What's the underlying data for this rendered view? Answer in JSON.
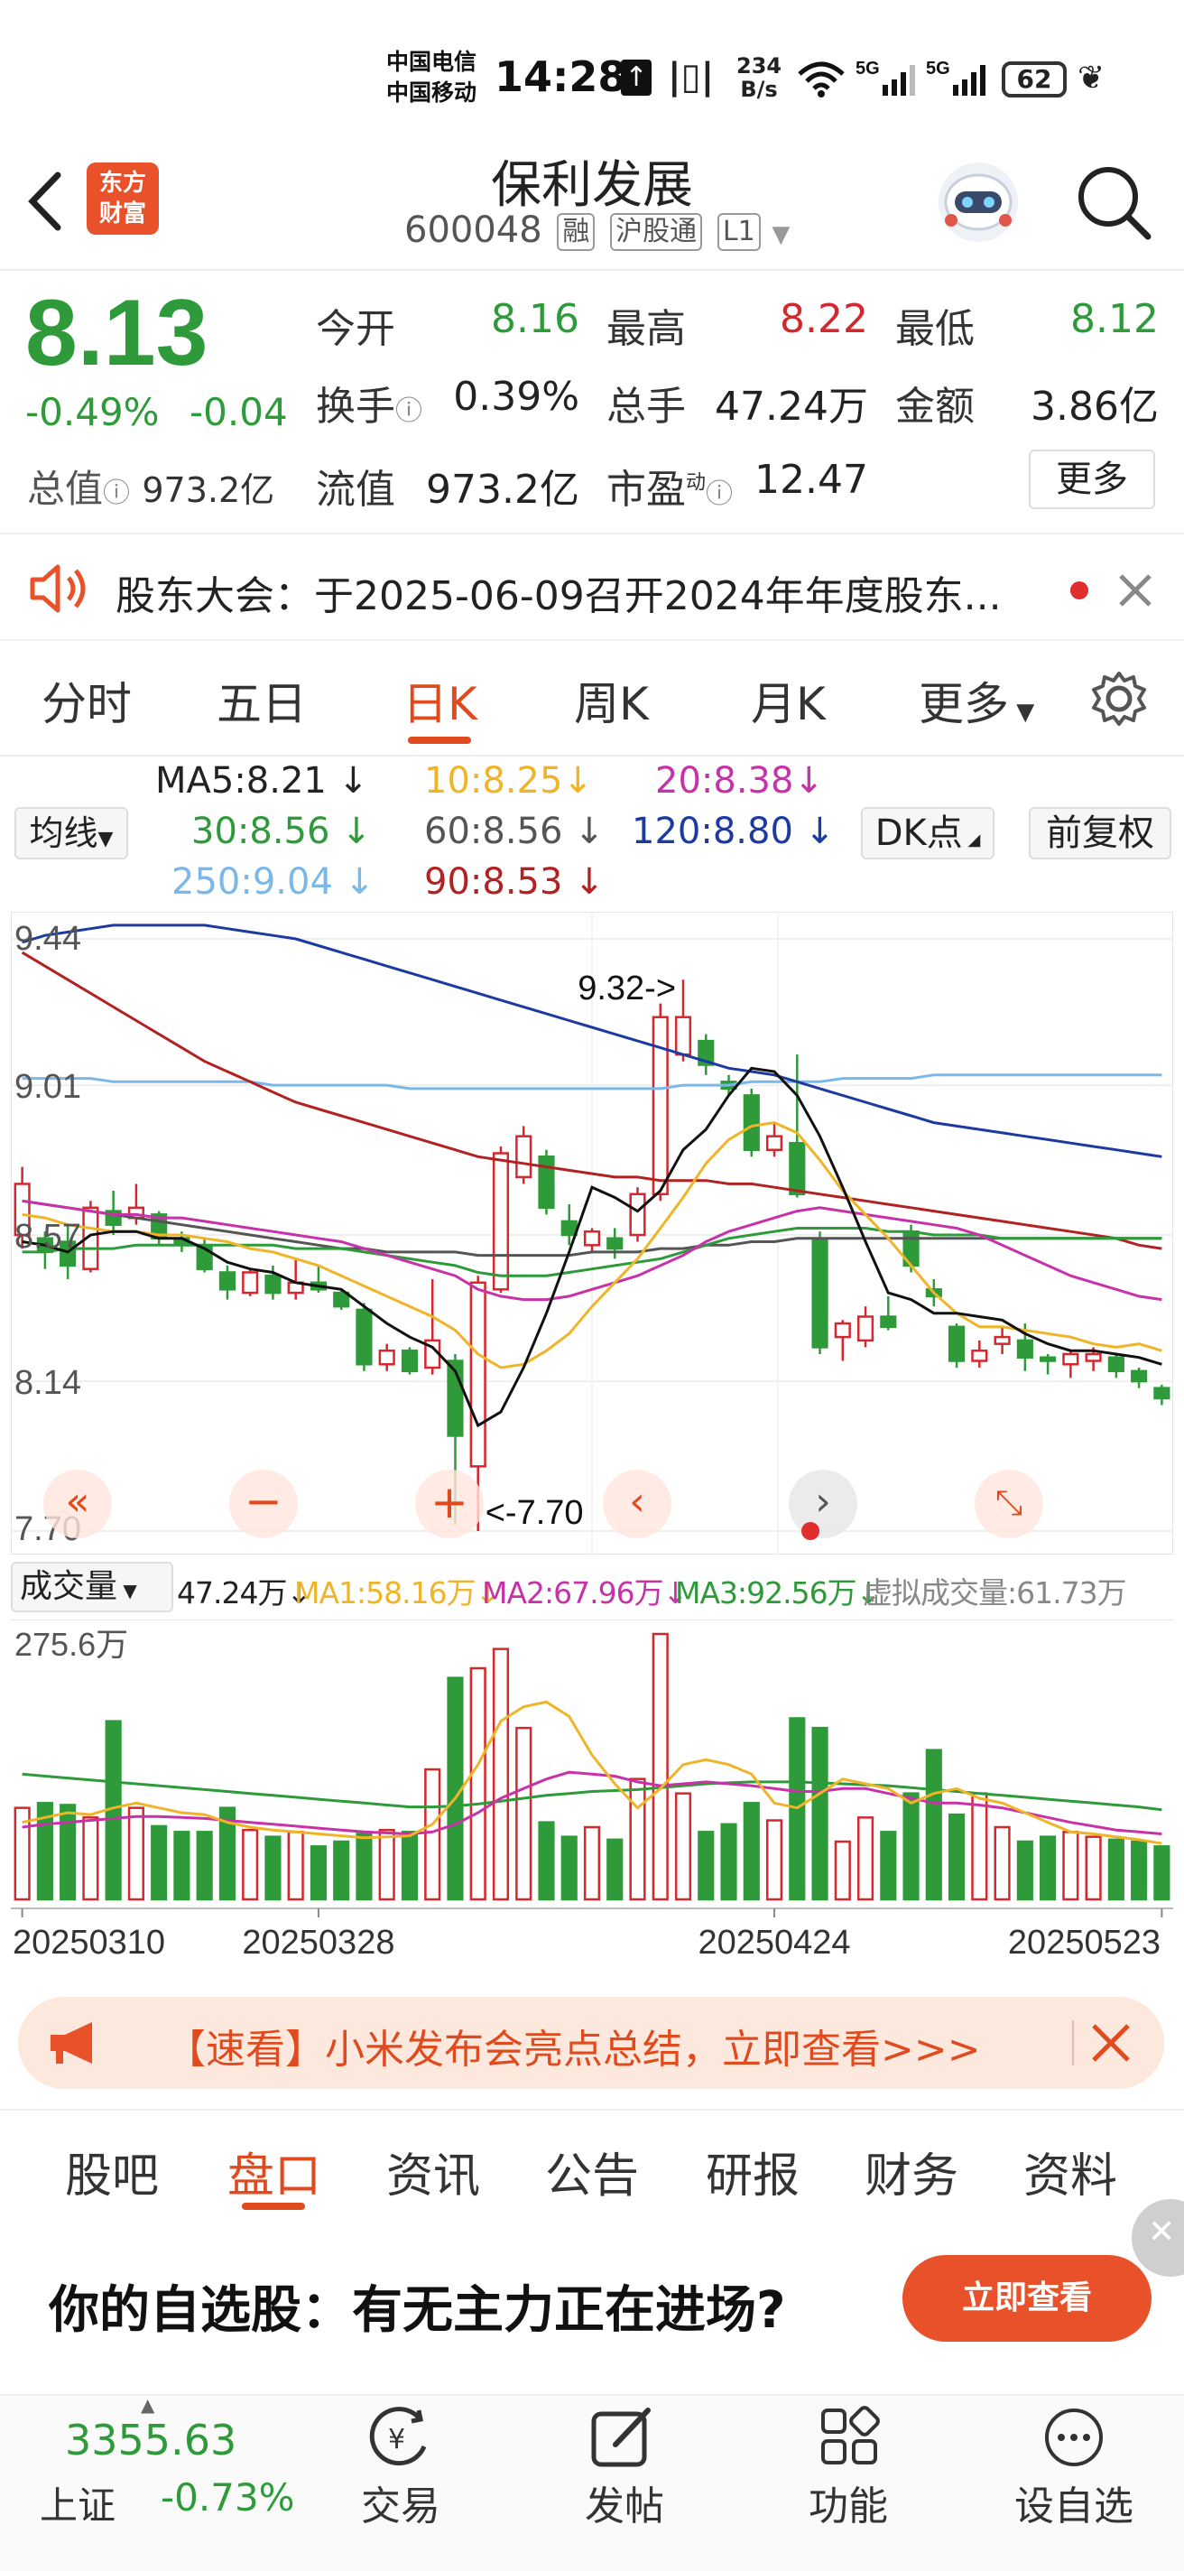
{
  "status_bar": {
    "carrier_1": "中国电信",
    "carrier_2": "中国移动",
    "time": "14:28",
    "net_speed_top": "234",
    "net_speed_bottom": "B/s",
    "battery": "62"
  },
  "header": {
    "logo_line1": "东方",
    "logo_line2": "财富",
    "stock_name": "保利发展",
    "stock_code": "600048",
    "tag_margin": "融",
    "tag_connect": "沪股通",
    "tag_level": "L1"
  },
  "quote": {
    "price": "8.13",
    "change_pct": "-0.49%",
    "change_abs": "-0.04",
    "open_label": "今开",
    "open_value": "8.16",
    "high_label": "最高",
    "high_value": "8.22",
    "low_label": "最低",
    "low_value": "8.12",
    "turnover_label": "换手",
    "turnover_value": "0.39%",
    "volume_label": "总手",
    "volume_value": "47.24万",
    "amount_label": "金额",
    "amount_value": "3.86亿",
    "mktcap_label": "总值",
    "mktcap_value": "973.2亿",
    "float_label": "流值",
    "float_value": "973.2亿",
    "pe_label": "市盈",
    "pe_sup": "动",
    "pe_value": "12.47",
    "more_label": "更多"
  },
  "notice": {
    "text": "股东大会：于2025-06-09召开2024年年度股东..."
  },
  "chart_tabs": [
    "分时",
    "五日",
    "日K",
    "周K",
    "月K",
    "更多"
  ],
  "chart_active_tab": "日K",
  "ma_legend": {
    "ma5": "MA5:8.21",
    "ma10": "10:8.25",
    "ma20": "20:8.38",
    "ma30": "30:8.56",
    "ma60": "60:8.56",
    "ma120": "120:8.80",
    "ma250": "250:9.04",
    "ma90": "90:8.53",
    "avg_line_label": "均线",
    "dk_label": "DK点",
    "adjust_label": "前复权"
  },
  "volume_legend": {
    "selector_label": "成交量",
    "volume": "47.24万",
    "ma1": "MA1:58.16万",
    "ma2": "MA2:67.96万",
    "ma3": "MA3:92.56万",
    "virtual": "虚拟成交量:61.73万"
  },
  "chart_data": {
    "type": "candlestick",
    "y_ticks": [
      "9.44",
      "9.01",
      "8.57",
      "8.14",
      "7.70"
    ],
    "ylim": [
      7.7,
      9.44
    ],
    "high_marker": "9.32->",
    "low_marker": "<-7.70",
    "volume_max_label": "275.6万",
    "dates": [
      "20250310",
      "20250328",
      "20250424",
      "20250523"
    ],
    "candles": [
      {
        "o": 8.57,
        "c": 8.72,
        "h": 8.77,
        "l": 8.53
      },
      {
        "o": 8.56,
        "c": 8.52,
        "h": 8.58,
        "l": 8.47
      },
      {
        "o": 8.55,
        "c": 8.48,
        "h": 8.6,
        "l": 8.44
      },
      {
        "o": 8.47,
        "c": 8.65,
        "h": 8.67,
        "l": 8.46
      },
      {
        "o": 8.64,
        "c": 8.6,
        "h": 8.7,
        "l": 8.57
      },
      {
        "o": 8.62,
        "c": 8.65,
        "h": 8.72,
        "l": 8.6
      },
      {
        "o": 8.63,
        "c": 8.56,
        "h": 8.64,
        "l": 8.54
      },
      {
        "o": 8.56,
        "c": 8.54,
        "h": 8.58,
        "l": 8.52
      },
      {
        "o": 8.54,
        "c": 8.47,
        "h": 8.56,
        "l": 8.46
      },
      {
        "o": 8.46,
        "c": 8.41,
        "h": 8.48,
        "l": 8.38
      },
      {
        "o": 8.4,
        "c": 8.46,
        "h": 8.47,
        "l": 8.39
      },
      {
        "o": 8.45,
        "c": 8.4,
        "h": 8.48,
        "l": 8.38
      },
      {
        "o": 8.4,
        "c": 8.43,
        "h": 8.5,
        "l": 8.38
      },
      {
        "o": 8.43,
        "c": 8.41,
        "h": 8.48,
        "l": 8.4
      },
      {
        "o": 8.4,
        "c": 8.36,
        "h": 8.41,
        "l": 8.35
      },
      {
        "o": 8.35,
        "c": 8.19,
        "h": 8.37,
        "l": 8.17
      },
      {
        "o": 8.19,
        "c": 8.23,
        "h": 8.25,
        "l": 8.17
      },
      {
        "o": 8.23,
        "c": 8.17,
        "h": 8.24,
        "l": 8.16
      },
      {
        "o": 8.18,
        "c": 8.26,
        "h": 8.44,
        "l": 8.16
      },
      {
        "o": 8.2,
        "c": 7.98,
        "h": 8.22,
        "l": 7.72
      },
      {
        "o": 7.89,
        "c": 8.43,
        "h": 8.45,
        "l": 7.7
      },
      {
        "o": 8.41,
        "c": 8.81,
        "h": 8.83,
        "l": 8.4
      },
      {
        "o": 8.74,
        "c": 8.86,
        "h": 8.89,
        "l": 8.72
      },
      {
        "o": 8.8,
        "c": 8.65,
        "h": 8.82,
        "l": 8.63
      },
      {
        "o": 8.61,
        "c": 8.57,
        "h": 8.66,
        "l": 8.54
      },
      {
        "o": 8.54,
        "c": 8.58,
        "h": 8.59,
        "l": 8.52
      },
      {
        "o": 8.56,
        "c": 8.53,
        "h": 8.59,
        "l": 8.5
      },
      {
        "o": 8.57,
        "c": 8.69,
        "h": 8.71,
        "l": 8.55
      },
      {
        "o": 8.69,
        "c": 9.21,
        "h": 9.25,
        "l": 8.67
      },
      {
        "o": 9.1,
        "c": 9.21,
        "h": 9.32,
        "l": 9.08
      },
      {
        "o": 9.14,
        "c": 9.07,
        "h": 9.16,
        "l": 9.04
      },
      {
        "o": 9.02,
        "c": 9.0,
        "h": 9.04,
        "l": 8.98
      },
      {
        "o": 8.98,
        "c": 8.82,
        "h": 9.0,
        "l": 8.8
      },
      {
        "o": 8.82,
        "c": 8.86,
        "h": 8.9,
        "l": 8.8
      },
      {
        "o": 8.84,
        "c": 8.69,
        "h": 9.1,
        "l": 8.68
      },
      {
        "o": 8.56,
        "c": 8.24,
        "h": 8.58,
        "l": 8.22
      },
      {
        "o": 8.27,
        "c": 8.31,
        "h": 8.32,
        "l": 8.2
      },
      {
        "o": 8.26,
        "c": 8.33,
        "h": 8.36,
        "l": 8.24
      },
      {
        "o": 8.33,
        "c": 8.3,
        "h": 8.39,
        "l": 8.29
      },
      {
        "o": 8.58,
        "c": 8.48,
        "h": 8.6,
        "l": 8.46
      },
      {
        "o": 8.41,
        "c": 8.39,
        "h": 8.44,
        "l": 8.36
      },
      {
        "o": 8.3,
        "c": 8.2,
        "h": 8.31,
        "l": 8.18
      },
      {
        "o": 8.2,
        "c": 8.23,
        "h": 8.26,
        "l": 8.18
      },
      {
        "o": 8.25,
        "c": 8.27,
        "h": 8.3,
        "l": 8.22
      },
      {
        "o": 8.26,
        "c": 8.21,
        "h": 8.31,
        "l": 8.17
      },
      {
        "o": 8.21,
        "c": 8.2,
        "h": 8.22,
        "l": 8.16
      },
      {
        "o": 8.19,
        "c": 8.22,
        "h": 8.23,
        "l": 8.15
      },
      {
        "o": 8.2,
        "c": 8.22,
        "h": 8.24,
        "l": 8.17
      },
      {
        "o": 8.21,
        "c": 8.17,
        "h": 8.22,
        "l": 8.15
      },
      {
        "o": 8.17,
        "c": 8.14,
        "h": 8.18,
        "l": 8.12
      },
      {
        "o": 8.12,
        "c": 8.09,
        "h": 8.13,
        "l": 8.07
      }
    ],
    "volumes": [
      95,
      100,
      98,
      85,
      185,
      95,
      76,
      70,
      70,
      95,
      72,
      65,
      70,
      55,
      60,
      68,
      72,
      70,
      135,
      230,
      240,
      260,
      178,
      80,
      65,
      75,
      62,
      125,
      275.6,
      110,
      70,
      78,
      100,
      82,
      188,
      178,
      60,
      85,
      70,
      110,
      155,
      88,
      110,
      75,
      60,
      65,
      70,
      65,
      62,
      60,
      55
    ],
    "ma5": [
      8.55,
      8.54,
      8.52,
      8.57,
      8.58,
      8.58,
      8.56,
      8.56,
      8.53,
      8.49,
      8.47,
      8.46,
      8.43,
      8.42,
      8.41,
      8.36,
      8.31,
      8.27,
      8.24,
      8.17,
      8.01,
      8.05,
      8.18,
      8.34,
      8.52,
      8.71,
      8.68,
      8.64,
      8.7,
      8.82,
      8.88,
      8.98,
      9.06,
      9.05,
      8.98,
      8.86,
      8.71,
      8.55,
      8.4,
      8.38,
      8.34,
      8.34,
      8.33,
      8.32,
      8.28,
      8.25,
      8.23,
      8.23,
      8.22,
      8.21,
      8.19
    ],
    "ma10": [
      8.63,
      8.62,
      8.6,
      8.59,
      8.58,
      8.58,
      8.57,
      8.57,
      8.56,
      8.55,
      8.53,
      8.52,
      8.5,
      8.48,
      8.45,
      8.42,
      8.39,
      8.36,
      8.33,
      8.29,
      8.22,
      8.18,
      8.19,
      8.23,
      8.28,
      8.36,
      8.43,
      8.5,
      8.59,
      8.68,
      8.78,
      8.85,
      8.89,
      8.9,
      8.87,
      8.79,
      8.7,
      8.63,
      8.56,
      8.48,
      8.4,
      8.34,
      8.3,
      8.3,
      8.29,
      8.28,
      8.27,
      8.25,
      8.24,
      8.25,
      8.23
    ],
    "ma20": [
      8.67,
      8.66,
      8.65,
      8.64,
      8.63,
      8.63,
      8.62,
      8.62,
      8.61,
      8.6,
      8.59,
      8.58,
      8.57,
      8.56,
      8.55,
      8.53,
      8.51,
      8.49,
      8.47,
      8.45,
      8.41,
      8.39,
      8.38,
      8.38,
      8.39,
      8.41,
      8.43,
      8.45,
      8.48,
      8.51,
      8.55,
      8.58,
      8.6,
      8.62,
      8.64,
      8.65,
      8.64,
      8.63,
      8.62,
      8.61,
      8.6,
      8.59,
      8.57,
      8.54,
      8.51,
      8.48,
      8.45,
      8.43,
      8.41,
      8.39,
      8.38
    ],
    "ma30": [
      8.52,
      8.52,
      8.53,
      8.53,
      8.53,
      8.54,
      8.54,
      8.54,
      8.54,
      8.54,
      8.54,
      8.54,
      8.53,
      8.53,
      8.53,
      8.52,
      8.51,
      8.5,
      8.49,
      8.48,
      8.46,
      8.45,
      8.45,
      8.45,
      8.46,
      8.47,
      8.48,
      8.49,
      8.5,
      8.52,
      8.54,
      8.56,
      8.57,
      8.58,
      8.59,
      8.59,
      8.59,
      8.59,
      8.58,
      8.58,
      8.57,
      8.57,
      8.57,
      8.56,
      8.56,
      8.56,
      8.56,
      8.56,
      8.56,
      8.56,
      8.56
    ],
    "ma60": [
      8.67,
      8.66,
      8.65,
      8.64,
      8.63,
      8.62,
      8.61,
      8.6,
      8.59,
      8.58,
      8.57,
      8.56,
      8.55,
      8.54,
      8.53,
      8.53,
      8.52,
      8.52,
      8.52,
      8.52,
      8.51,
      8.51,
      8.51,
      8.51,
      8.51,
      8.52,
      8.52,
      8.52,
      8.53,
      8.53,
      8.54,
      8.54,
      8.55,
      8.55,
      8.56,
      8.56,
      8.56,
      8.56,
      8.56,
      8.56,
      8.56,
      8.56,
      8.56,
      8.56,
      8.56,
      8.56,
      8.56,
      8.56,
      8.56,
      8.56,
      8.56
    ],
    "ma90": [
      9.4,
      9.36,
      9.32,
      9.28,
      9.24,
      9.2,
      9.16,
      9.12,
      9.08,
      9.05,
      9.02,
      8.99,
      8.96,
      8.94,
      8.92,
      8.9,
      8.88,
      8.86,
      8.84,
      8.82,
      8.8,
      8.79,
      8.78,
      8.77,
      8.76,
      8.75,
      8.74,
      8.74,
      8.73,
      8.73,
      8.73,
      8.72,
      8.72,
      8.71,
      8.7,
      8.69,
      8.68,
      8.67,
      8.66,
      8.65,
      8.64,
      8.63,
      8.62,
      8.61,
      8.6,
      8.59,
      8.58,
      8.57,
      8.56,
      8.54,
      8.53
    ],
    "ma120": [
      9.43,
      9.45,
      9.46,
      9.47,
      9.48,
      9.48,
      9.48,
      9.48,
      9.48,
      9.47,
      9.46,
      9.45,
      9.44,
      9.42,
      9.4,
      9.38,
      9.36,
      9.34,
      9.32,
      9.3,
      9.28,
      9.26,
      9.24,
      9.22,
      9.2,
      9.18,
      9.16,
      9.14,
      9.12,
      9.1,
      9.08,
      9.06,
      9.05,
      9.04,
      9.02,
      9.0,
      8.98,
      8.96,
      8.94,
      8.92,
      8.9,
      8.89,
      8.88,
      8.87,
      8.86,
      8.85,
      8.84,
      8.83,
      8.82,
      8.81,
      8.8
    ],
    "ma250": [
      9.03,
      9.03,
      9.03,
      9.03,
      9.02,
      9.02,
      9.02,
      9.02,
      9.02,
      9.02,
      9.02,
      9.01,
      9.01,
      9.01,
      9.01,
      9.01,
      9.01,
      9.0,
      9.0,
      9.0,
      9.0,
      9.0,
      9.0,
      9.0,
      9.0,
      9.0,
      9.0,
      9.0,
      9.0,
      9.01,
      9.01,
      9.01,
      9.02,
      9.02,
      9.02,
      9.02,
      9.03,
      9.03,
      9.03,
      9.03,
      9.04,
      9.04,
      9.04,
      9.04,
      9.04,
      9.04,
      9.04,
      9.04,
      9.04,
      9.04,
      9.04
    ],
    "vol_ma1": [
      80,
      85,
      90,
      88,
      95,
      100,
      95,
      90,
      88,
      80,
      75,
      72,
      70,
      68,
      66,
      64,
      65,
      66,
      78,
      105,
      140,
      185,
      200,
      205,
      190,
      150,
      120,
      95,
      115,
      140,
      145,
      140,
      130,
      100,
      95,
      110,
      125,
      120,
      115,
      100,
      110,
      115,
      105,
      100,
      90,
      80,
      70,
      68,
      65,
      62,
      58
    ],
    "vol_ma2": [
      75,
      78,
      80,
      82,
      84,
      86,
      86,
      85,
      84,
      82,
      80,
      78,
      76,
      74,
      72,
      70,
      69,
      68,
      70,
      78,
      90,
      105,
      115,
      125,
      132,
      130,
      128,
      122,
      118,
      120,
      122,
      120,
      118,
      115,
      112,
      112,
      115,
      115,
      110,
      105,
      100,
      100,
      98,
      95,
      90,
      85,
      80,
      76,
      72,
      70,
      68
    ],
    "vol_ma3": [
      130,
      128,
      126,
      124,
      122,
      120,
      118,
      116,
      114,
      112,
      110,
      108,
      106,
      104,
      102,
      100,
      98,
      96,
      96,
      97,
      99,
      102,
      105,
      108,
      110,
      112,
      113,
      114,
      116,
      118,
      120,
      121,
      122,
      122,
      122,
      121,
      120,
      119,
      118,
      116,
      114,
      112,
      110,
      108,
      106,
      104,
      102,
      100,
      98,
      96,
      93
    ]
  },
  "chart_controls": {
    "prev_icon": "double-chevron-left-icon",
    "zoom_out_icon": "minus-icon",
    "zoom_in_icon": "plus-icon",
    "left_icon": "chevron-left-icon",
    "right_icon": "chevron-right-icon",
    "fullscreen_icon": "expand-icon"
  },
  "promo_banner": {
    "text": "【速看】小米发布会亮点总结，立即查看>>>"
  },
  "bottom_tabs": [
    "股吧",
    "盘口",
    "资讯",
    "公告",
    "研报",
    "财务",
    "资料"
  ],
  "bottom_active_tab": "盘口",
  "ad": {
    "text": "你的自选股：有无主力正在进场?",
    "button": "立即查看"
  },
  "bottom_nav": {
    "index_value": "3355.63",
    "index_name": "上证",
    "index_change": "-0.73%",
    "trade": "交易",
    "post": "发帖",
    "features": "功能",
    "set_watchlist": "设自选"
  },
  "colors": {
    "up": "#d3282e",
    "down": "#2e9a3a",
    "accent": "#e04a1f",
    "ma5": "#111111",
    "ma10": "#f0b429",
    "ma20": "#c832a8",
    "ma30": "#2e9a3a",
    "ma60": "#555555",
    "ma90": "#b22222",
    "ma120": "#1c3aa0",
    "ma250": "#7ab8ea"
  }
}
